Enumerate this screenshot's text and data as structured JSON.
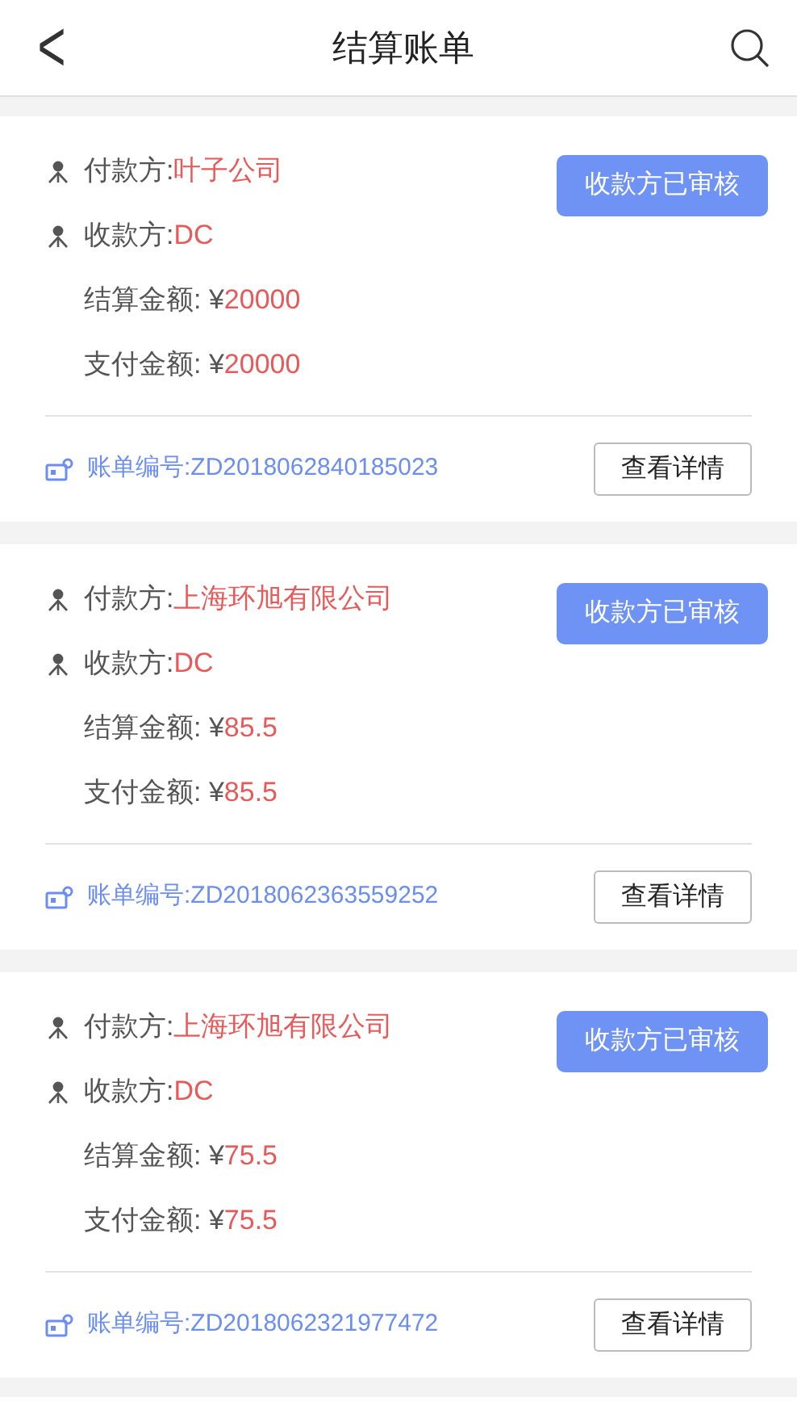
{
  "header": {
    "back": "<",
    "title": "结算账单"
  },
  "bills": [
    {
      "payer_label": "付款方:",
      "payer": "叶子公司",
      "payee_label": "收款方:",
      "payee": "DC",
      "settle_label": "结算金额: ¥",
      "settle": "20000",
      "paid_label": "支付金额: ¥",
      "paid": "20000",
      "status": "收款方已审核",
      "bill_no": "账单编号:ZD2018062840185023",
      "details": "查看详情"
    },
    {
      "payer_label": "付款方:",
      "payer": "上海环旭有限公司",
      "payee_label": "收款方:",
      "payee": "DC",
      "settle_label": "结算金额: ¥",
      "settle": "85.5",
      "paid_label": "支付金额: ¥",
      "paid": "85.5",
      "status": "收款方已审核",
      "bill_no": "账单编号:ZD2018062363559252",
      "details": "查看详情"
    },
    {
      "payer_label": "付款方:",
      "payer": "上海环旭有限公司",
      "payee_label": "收款方:",
      "payee": "DC",
      "settle_label": "结算金额: ¥",
      "settle": "75.5",
      "paid_label": "支付金额: ¥",
      "paid": "75.5",
      "status": "收款方已审核",
      "bill_no": "账单编号:ZD2018062321977472",
      "details": "查看详情"
    }
  ]
}
